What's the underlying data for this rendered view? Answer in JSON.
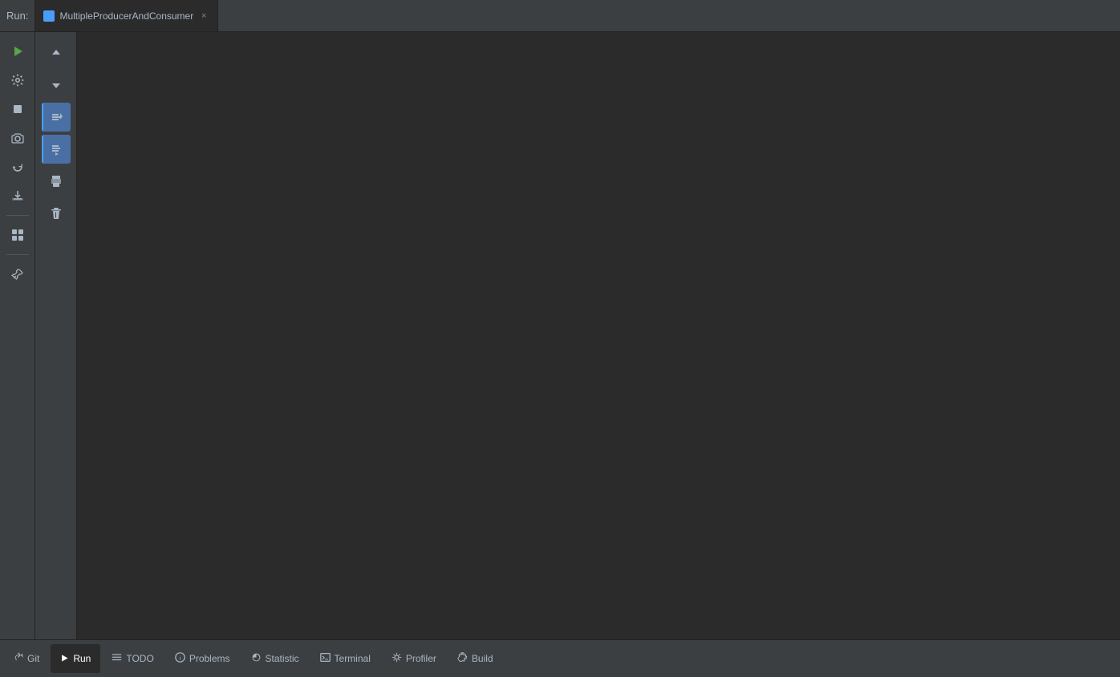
{
  "tabbar": {
    "run_label": "Run:",
    "tab": {
      "name": "MultipleProducerAndConsumer",
      "icon_color": "#4a9df8",
      "close_label": "×"
    }
  },
  "left_sidebar": {
    "buttons": [
      {
        "id": "run-icon",
        "symbol": "▶",
        "tooltip": "Run",
        "active": false
      },
      {
        "id": "wrench-icon",
        "symbol": "🔧",
        "tooltip": "Settings",
        "active": false
      },
      {
        "id": "stop-icon",
        "symbol": "■",
        "tooltip": "Stop",
        "active": false
      },
      {
        "id": "snapshot-icon",
        "symbol": "📷",
        "tooltip": "Snapshot",
        "active": false
      },
      {
        "id": "sync-icon",
        "symbol": "⟳",
        "tooltip": "Sync",
        "active": false
      },
      {
        "id": "import-icon",
        "symbol": "⬛",
        "tooltip": "Import",
        "active": false
      },
      {
        "id": "layout-icon",
        "symbol": "⊞",
        "tooltip": "Layout",
        "active": false
      },
      {
        "id": "pin-icon",
        "symbol": "📌",
        "tooltip": "Pin",
        "active": false
      }
    ]
  },
  "run_toolbar": {
    "buttons": [
      {
        "id": "up-btn",
        "symbol": "↑",
        "tooltip": "Up"
      },
      {
        "id": "down-btn",
        "symbol": "↓",
        "tooltip": "Down"
      },
      {
        "id": "rerun-btn",
        "symbol": "⟳≡",
        "tooltip": "Rerun",
        "active": true
      },
      {
        "id": "step-btn",
        "symbol": "⬇≡",
        "tooltip": "Step",
        "active": true
      },
      {
        "id": "print-btn",
        "symbol": "🖨",
        "tooltip": "Print"
      },
      {
        "id": "delete-btn",
        "symbol": "🗑",
        "tooltip": "Delete"
      }
    ]
  },
  "bottom_tabs": [
    {
      "id": "git-tab",
      "icon": "git-icon",
      "icon_symbol": "↵",
      "label": "Git"
    },
    {
      "id": "run-tab",
      "icon": "run-icon",
      "icon_symbol": "▶",
      "label": "Run",
      "active": true
    },
    {
      "id": "todo-tab",
      "icon": "todo-icon",
      "icon_symbol": "≡",
      "label": "TODO"
    },
    {
      "id": "problems-tab",
      "icon": "problems-icon",
      "icon_symbol": "ℹ",
      "label": "Problems"
    },
    {
      "id": "statistic-tab",
      "icon": "statistic-icon",
      "icon_symbol": "◑",
      "label": "Statistic"
    },
    {
      "id": "terminal-tab",
      "icon": "terminal-icon",
      "icon_symbol": "⬛",
      "label": "Terminal"
    },
    {
      "id": "profiler-tab",
      "icon": "profiler-icon",
      "icon_symbol": "🔍",
      "label": "Profiler"
    },
    {
      "id": "build-tab",
      "icon": "build-icon",
      "icon_symbol": "🔨",
      "label": "Build"
    }
  ]
}
